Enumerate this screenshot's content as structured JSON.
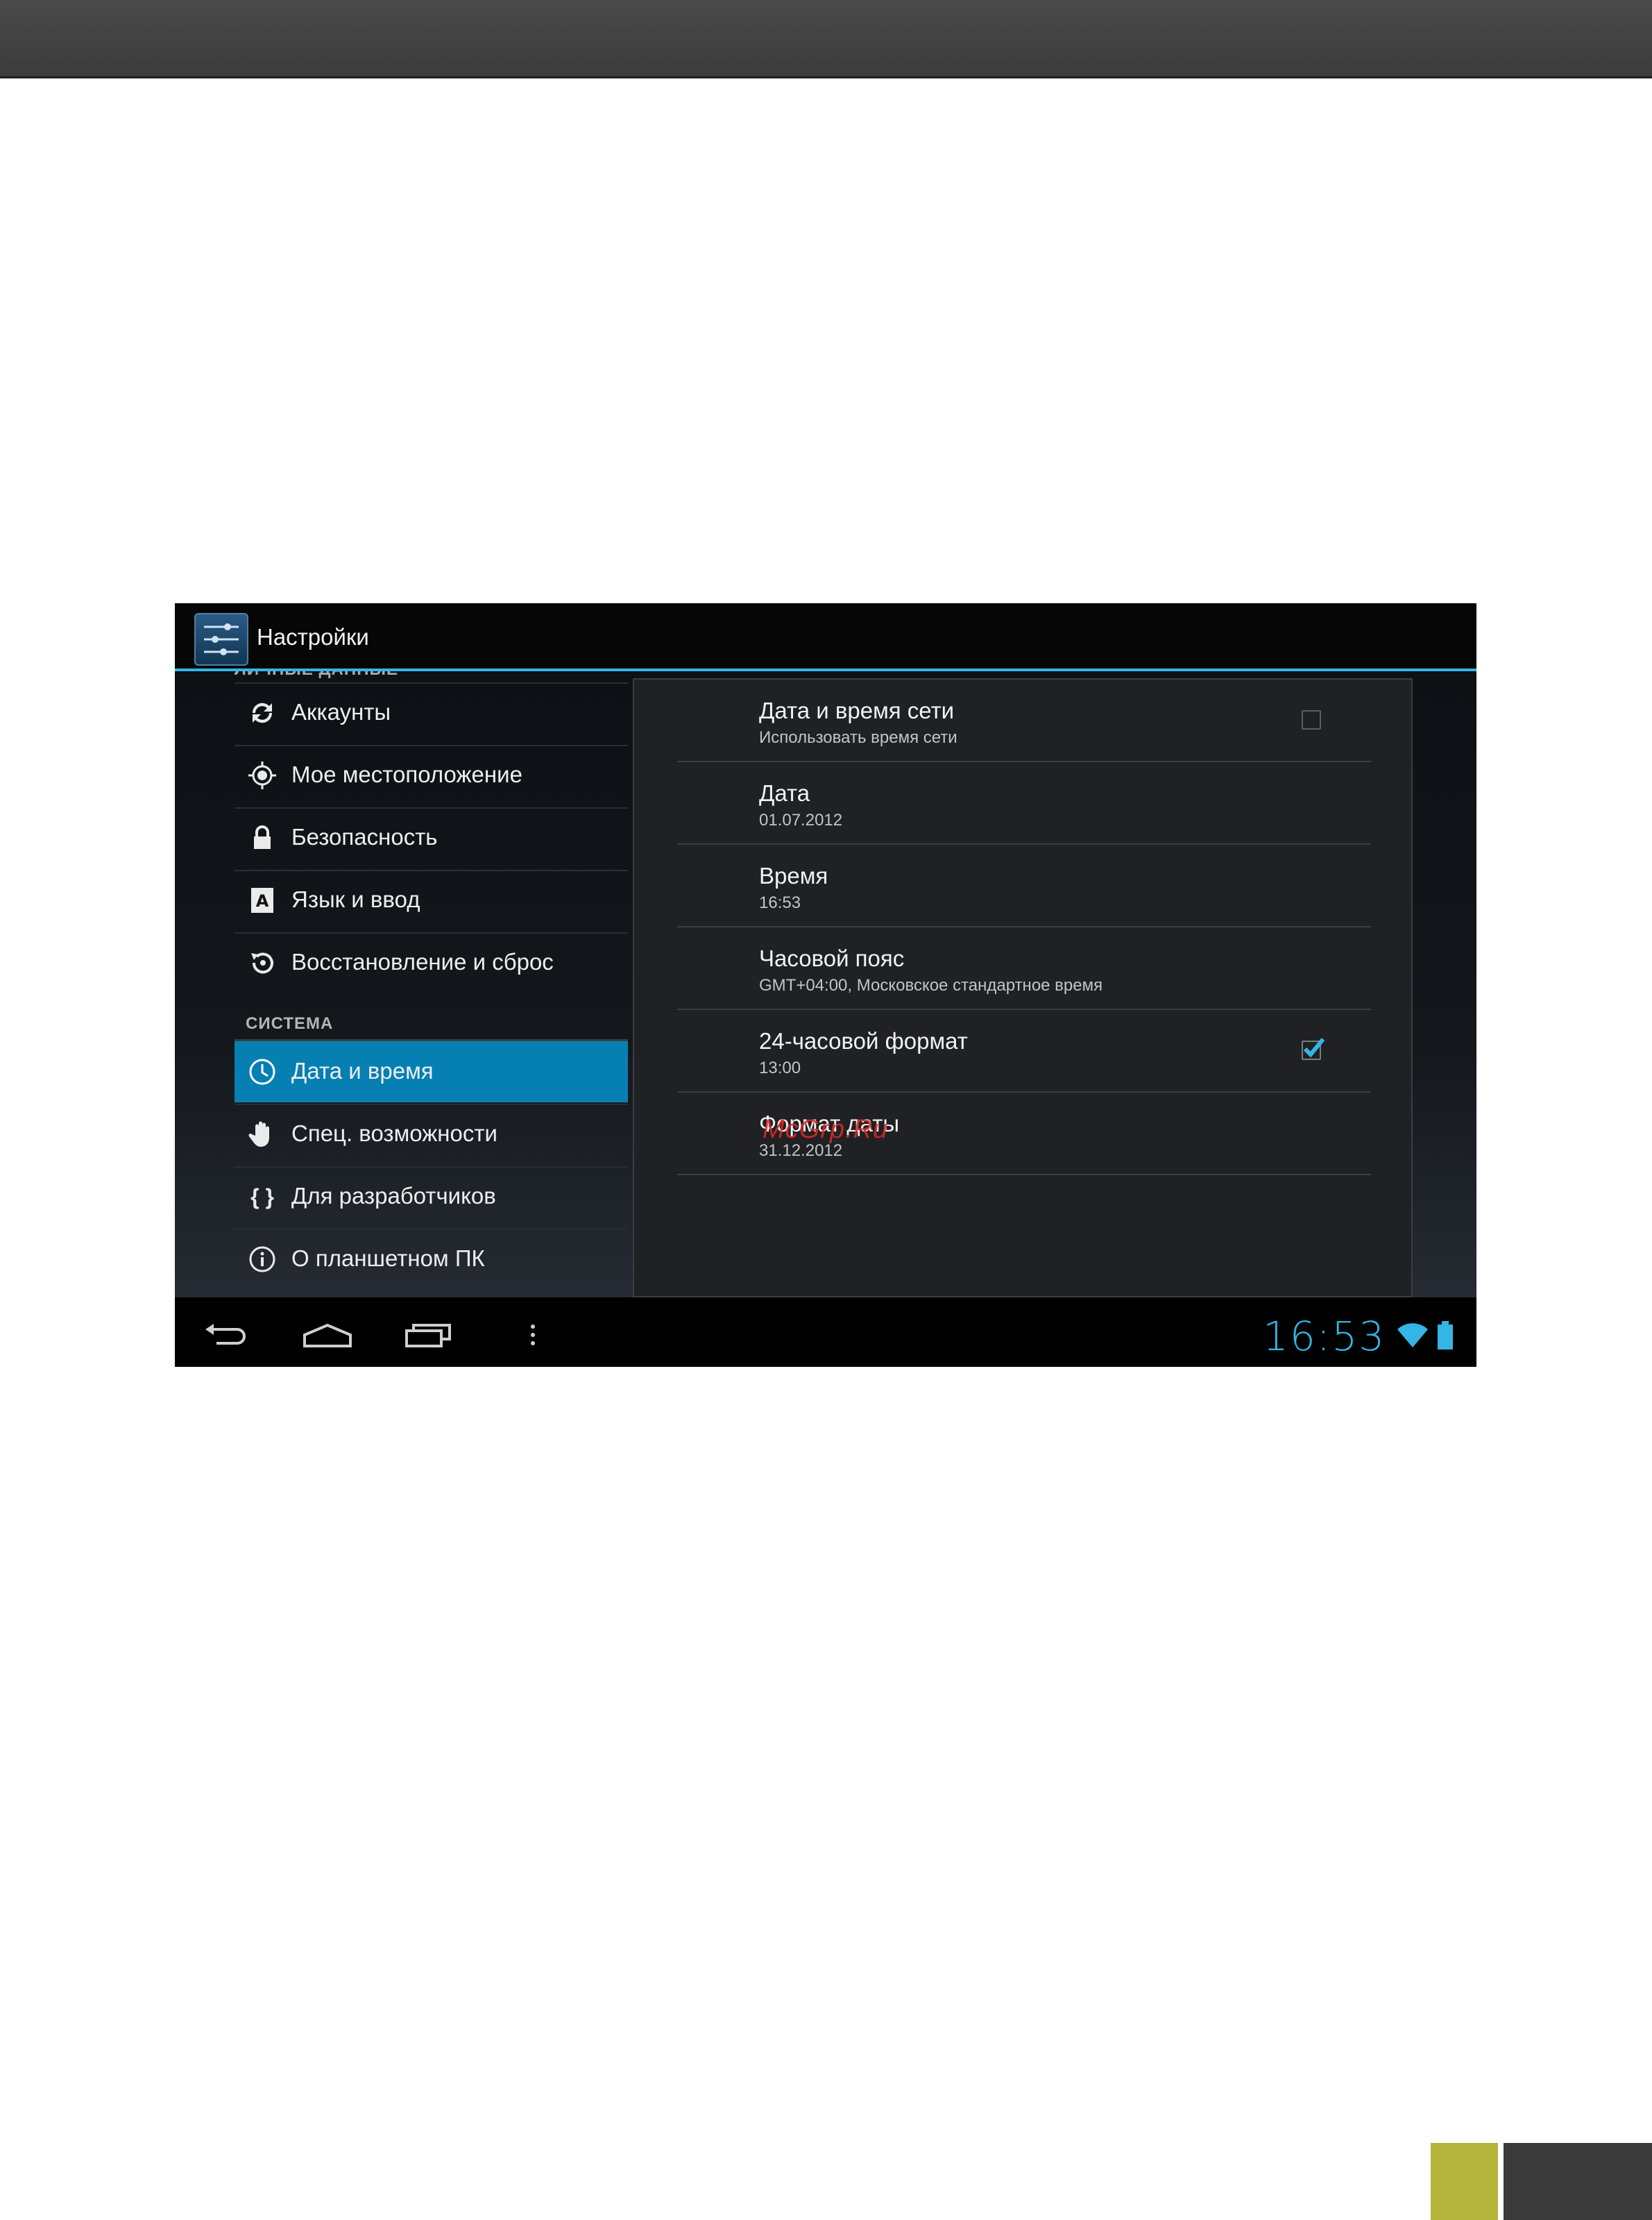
{
  "app": {
    "title": "Настройки",
    "icon": "settings-sliders-icon"
  },
  "sidebar": {
    "cut_header": "ЛИЧНЫЕ ДАННЫЕ",
    "items": [
      {
        "label": "Аккаунты",
        "icon": "sync-icon"
      },
      {
        "label": "Мое местоположение",
        "icon": "location-icon"
      },
      {
        "label": "Безопасность",
        "icon": "lock-icon"
      },
      {
        "label": "Язык и ввод",
        "icon": "language-icon"
      },
      {
        "label": "Восстановление и сброс",
        "icon": "restore-icon"
      }
    ],
    "system_header": "СИСТЕМА",
    "system_items": [
      {
        "label": "Дата и время",
        "icon": "clock-icon",
        "selected": true
      },
      {
        "label": "Спец. возможности",
        "icon": "hand-icon"
      },
      {
        "label": "Для разработчиков",
        "icon": "braces-icon",
        "glyph": "{ }"
      },
      {
        "label": "О планшетном ПК",
        "icon": "info-icon"
      }
    ]
  },
  "detail": {
    "prefs": [
      {
        "title": "Дата и время сети",
        "summary": "Использовать время сети",
        "checkbox": true,
        "checked": false
      },
      {
        "title": "Дата",
        "summary": "01.07.2012"
      },
      {
        "title": "Время",
        "summary": "16:53"
      },
      {
        "title": "Часовой пояс",
        "summary": "GMT+04:00, Московское стандартное время"
      },
      {
        "title": "24-часовой формат",
        "summary": "13:00",
        "checkbox": true,
        "checked": true
      },
      {
        "title": "Формат даты",
        "summary": "31.12.2012"
      }
    ],
    "watermark": "McGrp.Ru"
  },
  "navbar": {
    "buttons": [
      "back-icon",
      "home-icon",
      "recents-icon",
      "menu-icon"
    ],
    "clock": "16:53",
    "status_icons": [
      "wifi-icon",
      "battery-icon"
    ]
  },
  "colors": {
    "accent": "#33b5e5",
    "selected": "#0680b2",
    "page_accent": "#b3b53c"
  }
}
